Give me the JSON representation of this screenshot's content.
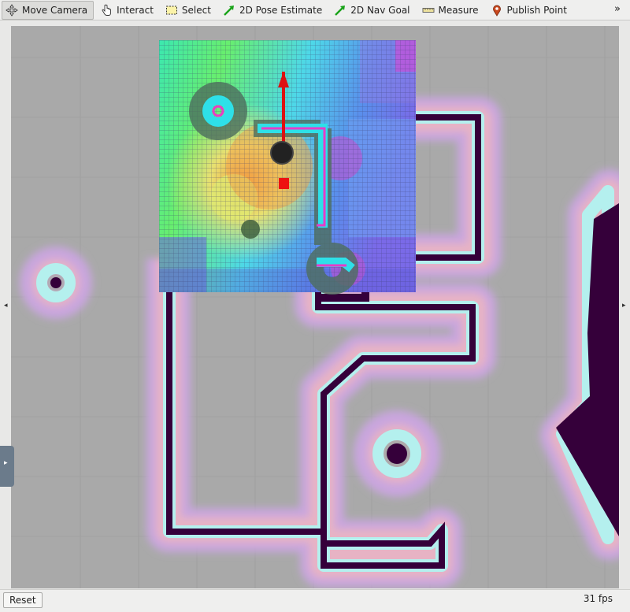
{
  "toolbar": {
    "tools": [
      {
        "label": "Move Camera",
        "icon": "move-camera-icon",
        "active": true
      },
      {
        "label": "Interact",
        "icon": "hand-pointer-icon"
      },
      {
        "label": "Select",
        "icon": "select-box-icon"
      },
      {
        "label": "2D Pose Estimate",
        "icon": "green-arrow-icon"
      },
      {
        "label": "2D Nav Goal",
        "icon": "green-arrow-icon"
      },
      {
        "label": "Measure",
        "icon": "ruler-icon"
      },
      {
        "label": "Publish Point",
        "icon": "map-pin-icon"
      }
    ],
    "more": "»"
  },
  "viewport": {
    "left_arrow": "◂",
    "right_arrow": "▸",
    "panel_toggle": "▸"
  },
  "bottom": {
    "reset_label": "Reset",
    "fps": "31 fps"
  },
  "colors": {
    "background_gray": "#a9a9a9",
    "wall": "#35003a",
    "inflation_cyan": "#b4f0ee",
    "halo_pink": "#e8b0c0",
    "halo_lavender": "#c8a8dc",
    "robot_arrow": "#dd1111",
    "goal_marker": "#ee1111"
  }
}
